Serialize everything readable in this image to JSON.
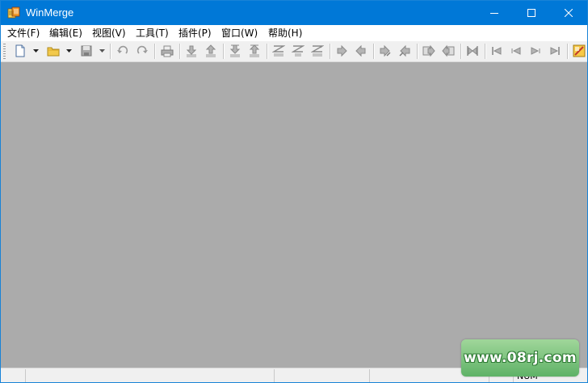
{
  "window": {
    "title": "WinMerge"
  },
  "menu": [
    {
      "label": "文件(F)"
    },
    {
      "label": "编辑(E)"
    },
    {
      "label": "视图(V)"
    },
    {
      "label": "工具(T)"
    },
    {
      "label": "插件(P)"
    },
    {
      "label": "窗口(W)"
    },
    {
      "label": "帮助(H)"
    }
  ],
  "toolbar": {
    "buttons": [
      "new-document-icon",
      "open-folder-icon",
      "save-icon",
      "undo-icon",
      "redo-icon",
      "print-icon",
      "next-diff-icon",
      "prev-diff-icon",
      "first-diff-icon",
      "last-diff-icon",
      "current-diff-icon",
      "copy-right-icon",
      "copy-left-icon",
      "copy-right-advance-icon",
      "copy-left-advance-icon",
      "all-right-icon",
      "all-left-icon",
      "compare-icon",
      "first-file-icon",
      "prev-file-icon",
      "next-file-icon",
      "last-file-icon",
      "options-icon"
    ]
  },
  "status": {
    "num": "NUM"
  },
  "watermark": {
    "text": "www.08rj.com"
  },
  "colors": {
    "titlebar": "#0078d7",
    "workspace": "#ababab",
    "toolbar": "#f0f0f0"
  }
}
